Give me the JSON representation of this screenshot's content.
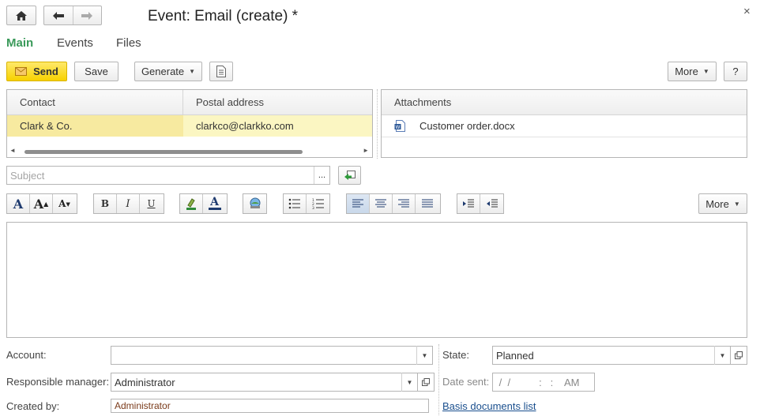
{
  "window": {
    "title": "Event: Email (create) *",
    "close_glyph": "×"
  },
  "tabs": [
    {
      "label": "Main",
      "active": true
    },
    {
      "label": "Events",
      "active": false
    },
    {
      "label": "Files",
      "active": false
    }
  ],
  "toolbar": {
    "send_label": "Send",
    "save_label": "Save",
    "generate_label": "Generate",
    "more_label": "More",
    "help_label": "?"
  },
  "contacts": {
    "columns": [
      "Contact",
      "Postal address"
    ],
    "rows": [
      {
        "contact": "Clark & Co.",
        "address": "clarkco@clarkko.com"
      }
    ]
  },
  "attachments": {
    "header": "Attachments",
    "files": [
      {
        "name": "Customer order.docx",
        "icon": "word-document-icon"
      }
    ]
  },
  "subject": {
    "placeholder": "Subject",
    "value": "",
    "select_label": "..."
  },
  "format_toolbar": {
    "more_label": "More",
    "alignment_active": "left"
  },
  "form": {
    "account_label": "Account:",
    "account_value": "",
    "responsible_label": "Responsible manager:",
    "responsible_value": "Administrator",
    "created_by_label": "Created by:",
    "created_by_value": "Administrator",
    "state_label": "State:",
    "state_value": "Planned",
    "date_sent_label": "Date sent:",
    "date_sent_value": " /  /          :   :    AM",
    "basis_link": "Basis documents list"
  },
  "colors": {
    "accent_green": "#3a9a5a",
    "send_yellow": "#f7d100",
    "selected_row": "#fbf6c2",
    "link_blue": "#1a4f8e"
  }
}
